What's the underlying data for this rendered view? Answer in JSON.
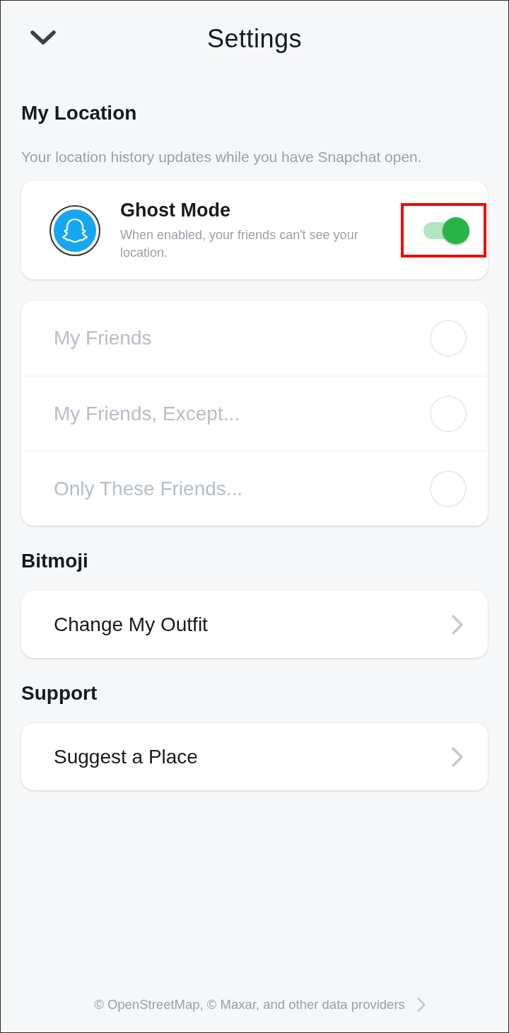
{
  "header": {
    "title": "Settings"
  },
  "location": {
    "heading": "My Location",
    "description": "Your location history updates while you have Snapchat open.",
    "ghost_mode": {
      "title": "Ghost Mode",
      "description": "When enabled, your friends can't see your location.",
      "on": true,
      "highlighted": true
    },
    "options": [
      {
        "label": "My Friends",
        "selected": false,
        "disabled": true
      },
      {
        "label": "My Friends, Except...",
        "selected": false,
        "disabled": true
      },
      {
        "label": "Only These Friends...",
        "selected": false,
        "disabled": true
      }
    ]
  },
  "link_sections": [
    {
      "heading": "Bitmoji",
      "items": [
        {
          "label": "Change My Outfit"
        }
      ]
    },
    {
      "heading": "Support",
      "items": [
        {
          "label": "Suggest a Place"
        }
      ]
    }
  ],
  "footer": {
    "text": "© OpenStreetMap, © Maxar, and other data providers"
  }
}
